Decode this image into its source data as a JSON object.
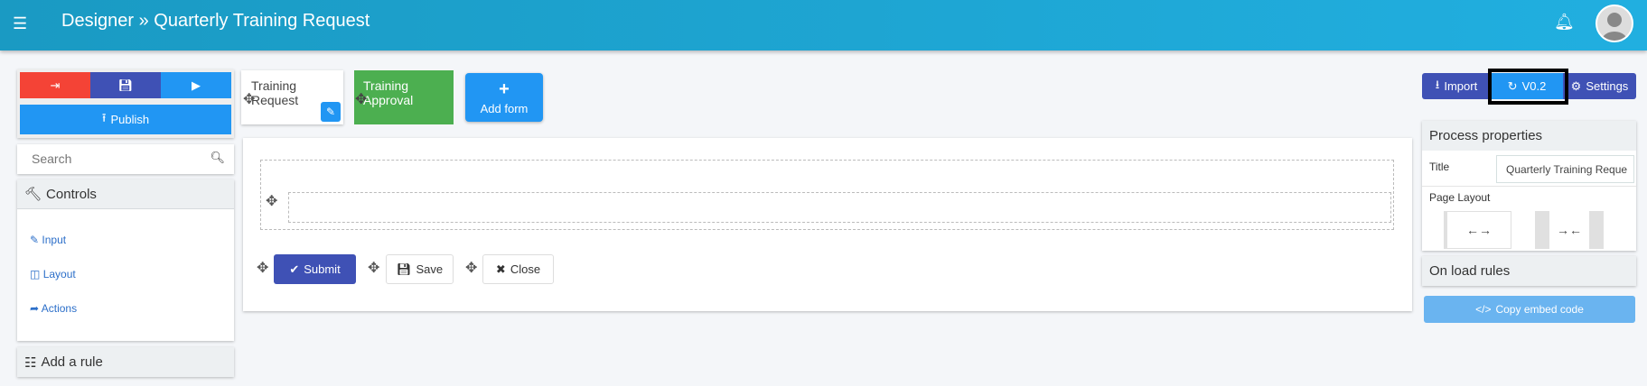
{
  "header": {
    "menu_icon": "hamburger-icon",
    "title": "Designer » Quarterly Training Request",
    "bell_icon": "bell-icon",
    "avatar_icon": "user-avatar"
  },
  "left": {
    "exit_icon": "sign-out-icon",
    "save_icon": "floppy-icon",
    "run_icon": "play-icon",
    "publish": "Publish",
    "search_placeholder": "Search",
    "controls": "Controls",
    "items": [
      {
        "icon": "edit-icon",
        "label": "Input"
      },
      {
        "icon": "columns-icon",
        "label": "Layout"
      },
      {
        "icon": "share-icon",
        "label": "Actions"
      }
    ],
    "add_rule": "Add a rule"
  },
  "forms": {
    "tabs": [
      {
        "label": "Training Request"
      },
      {
        "label": "Training Approval"
      }
    ],
    "add_form": "Add form"
  },
  "canvas": {
    "submit": "Submit",
    "save": "Save",
    "close": "Close"
  },
  "right": {
    "import": "Import",
    "version": "V0.2",
    "settings": "Settings",
    "process_properties": "Process properties",
    "title_label": "Title",
    "title_value": "Quarterly Training Reque",
    "page_layout": "Page Layout",
    "on_load_rules": "On load rules",
    "copy_embed": "Copy embed code"
  },
  "colors": {
    "header": "#1a9ac3",
    "red": "#f44336",
    "indigo": "#3f51b5",
    "blue": "#2196f3",
    "green": "#4caf50",
    "light_blue": "#6ab4f0"
  }
}
